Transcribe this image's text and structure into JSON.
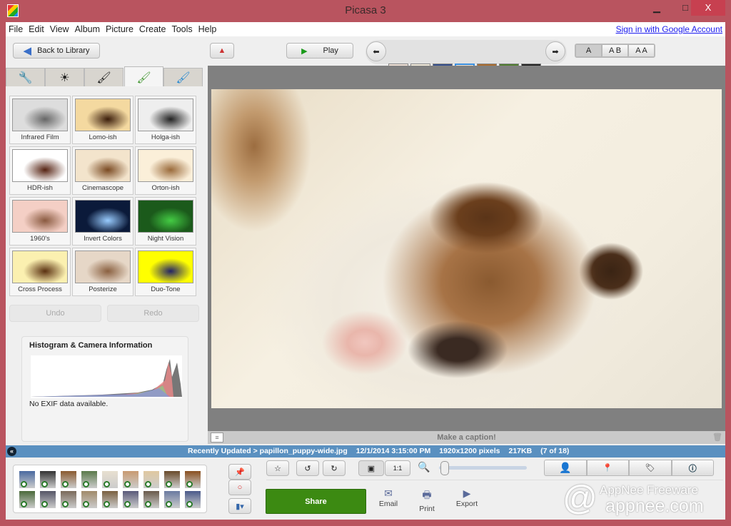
{
  "window": {
    "title": "Picasa 3",
    "minimize": "▁",
    "maximize": "□",
    "close": "X"
  },
  "menu": [
    "File",
    "Edit",
    "View",
    "Album",
    "Picture",
    "Create",
    "Tools",
    "Help"
  ],
  "signin": "Sign in with Google Account",
  "toolbar": {
    "back": "Back to Library",
    "play": "Play",
    "caption_modes": [
      "A",
      "A B",
      "A A"
    ]
  },
  "effects": [
    {
      "label": "Infrared Film",
      "colors": [
        "#ddd",
        "#666"
      ]
    },
    {
      "label": "Lomo-ish",
      "colors": [
        "#f4d9a0",
        "#3b1d0a"
      ]
    },
    {
      "label": "Holga-ish",
      "colors": [
        "#eee",
        "#222"
      ]
    },
    {
      "label": "HDR-ish",
      "colors": [
        "#fff",
        "#521"
      ]
    },
    {
      "label": "Cinemascope",
      "colors": [
        "#f3e4cc",
        "#7a4a22"
      ]
    },
    {
      "label": "Orton-ish",
      "colors": [
        "#fbefd9",
        "#9a6a3a"
      ]
    },
    {
      "label": "1960's",
      "colors": [
        "#f4cfc5",
        "#8a5a40"
      ]
    },
    {
      "label": "Invert Colors",
      "colors": [
        "#0b1a3a",
        "#9cf"
      ]
    },
    {
      "label": "Night Vision",
      "colors": [
        "#1b5a1b",
        "#4c4"
      ]
    },
    {
      "label": "Cross Process",
      "colors": [
        "#fbf0b0",
        "#5a3010"
      ]
    },
    {
      "label": "Posterize",
      "colors": [
        "#e6d7c7",
        "#8a6040"
      ]
    },
    {
      "label": "Duo-Tone",
      "colors": [
        "#ff0",
        "#226"
      ]
    }
  ],
  "undo": "Undo",
  "redo": "Redo",
  "histogram": {
    "title": "Histogram & Camera Information",
    "exif": "No EXIF data available."
  },
  "caption_placeholder": "Make a caption!",
  "status": {
    "path": "Recently Updated > papillon_puppy-wide.jpg",
    "date": "12/1/2014 3:15:00 PM",
    "dimensions": "1920x1200 pixels",
    "size": "217KB",
    "position": "(7 of 18)"
  },
  "actions": {
    "share": "Share",
    "email": "Email",
    "print": "Print",
    "export": "Export"
  },
  "watermark": {
    "line1": "AppNee Freeware",
    "line2": "appnee.com"
  },
  "colors": {
    "title_bar": "#b9545f",
    "status_bar": "#5a90c0",
    "share": "#3c8a12"
  }
}
